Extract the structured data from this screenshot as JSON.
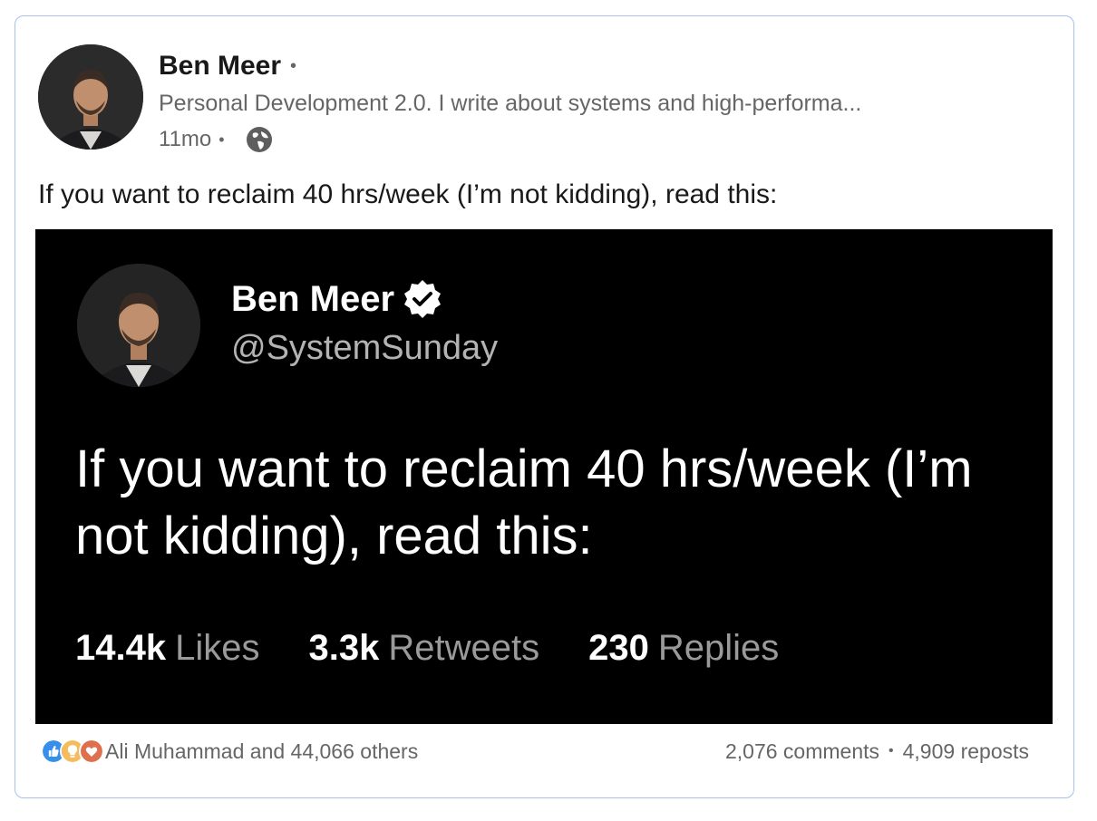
{
  "post": {
    "author": {
      "name": "Ben Meer",
      "headline": "Personal Development 2.0. I write about systems and high-performa...",
      "age": "11mo",
      "visibility_icon": "globe-icon"
    },
    "text": "If you want to reclaim 40 hrs/week (I’m not kidding), read this:",
    "embed": {
      "name": "Ben Meer",
      "verified_icon": "verified-badge-icon",
      "handle": "@SystemSunday",
      "text": "If you want to reclaim 40 hrs/week (I’m not kidding), read this:",
      "stats": [
        {
          "value": "14.4k",
          "label": "Likes"
        },
        {
          "value": "3.3k",
          "label": "Retweets"
        },
        {
          "value": "230",
          "label": "Replies"
        }
      ]
    },
    "social": {
      "reaction_icons": [
        "like-icon",
        "insightful-icon",
        "love-icon"
      ],
      "reactions_text": "Ali Muhammad and 44,066 others",
      "comments": "2,076 comments",
      "reposts": "4,909 reposts"
    }
  },
  "colors": {
    "border": "#a9bff0",
    "muted_text": "#666666",
    "embed_bg": "#000000",
    "like_blue": "#378fe9",
    "insight_yellow": "#f5bb5c",
    "love_red": "#df704d"
  }
}
